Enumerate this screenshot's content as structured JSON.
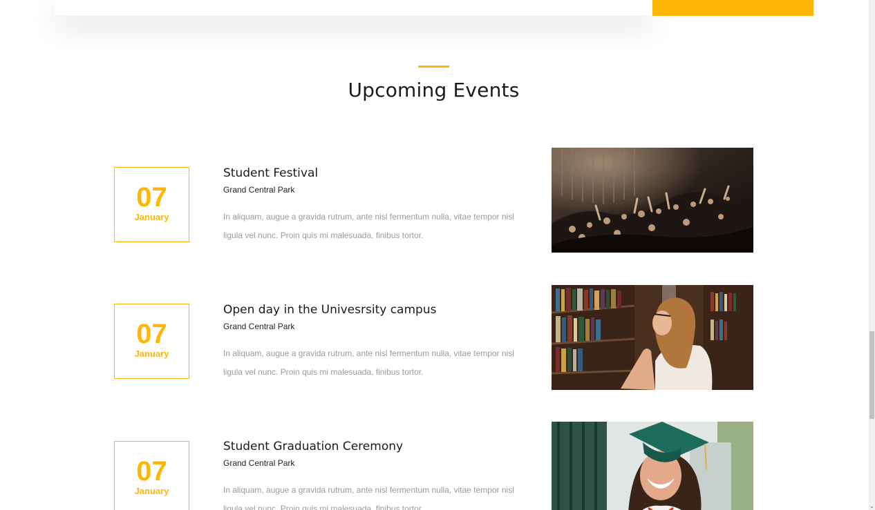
{
  "section": {
    "title": "Upcoming Events"
  },
  "events": [
    {
      "day": "07",
      "month": "January",
      "title": "Student Festival",
      "location": "Grand Central Park",
      "description": "In aliquam, augue a gravida rutrum, ante nisl fermentum nulla, vitae tempor nisl ligula vel nunc. Proin quis mi malesuada, finibus tortor.",
      "image": "concert-crowd-photo"
    },
    {
      "day": "07",
      "month": "January",
      "title": "Open day in the Univesrsity campus",
      "location": "Grand Central Park",
      "description": "In aliquam, augue a gravida rutrum, ante nisl fermentum nulla, vitae tempor nisl ligula vel nunc. Proin quis mi malesuada, finibus tortor.",
      "image": "library-student-photo"
    },
    {
      "day": "07",
      "month": "January",
      "title": "Student Graduation Ceremony",
      "location": "Grand Central Park",
      "description": "In aliquam, augue a gravida rutrum, ante nisl fermentum nulla, vitae tempor nisl ligula vel nunc. Proin quis mi malesuada, finibus tortor.",
      "image": "graduate-smiling-photo"
    }
  ],
  "colors": {
    "accent": "#ffb606",
    "heading": "#1a1a1a",
    "muted_text": "#9a9a9a"
  }
}
